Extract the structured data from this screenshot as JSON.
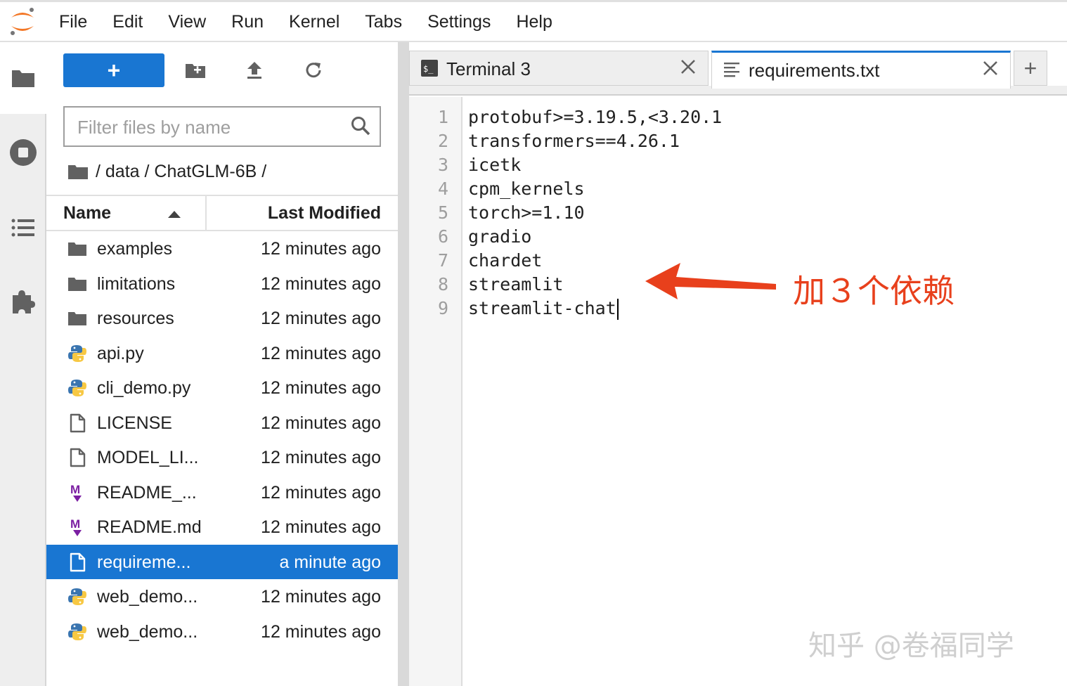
{
  "menu": [
    "File",
    "Edit",
    "View",
    "Run",
    "Kernel",
    "Tabs",
    "Settings",
    "Help"
  ],
  "activity_bar": [
    "folder-icon",
    "stop-circle-icon",
    "list-icon",
    "puzzle-icon"
  ],
  "file_browser": {
    "new_button_label": "+",
    "filter_placeholder": "Filter files by name",
    "breadcrumb": "/ data / ChatGLM-6B /",
    "columns": {
      "name": "Name",
      "modified": "Last Modified"
    },
    "files": [
      {
        "name": "examples",
        "modified": "12 minutes ago",
        "icon": "folder-icon"
      },
      {
        "name": "limitations",
        "modified": "12 minutes ago",
        "icon": "folder-icon"
      },
      {
        "name": "resources",
        "modified": "12 minutes ago",
        "icon": "folder-icon"
      },
      {
        "name": "api.py",
        "modified": "12 minutes ago",
        "icon": "python-icon"
      },
      {
        "name": "cli_demo.py",
        "modified": "12 minutes ago",
        "icon": "python-icon"
      },
      {
        "name": "LICENSE",
        "modified": "12 minutes ago",
        "icon": "file-icon"
      },
      {
        "name": "MODEL_LI...",
        "modified": "12 minutes ago",
        "icon": "file-icon"
      },
      {
        "name": "README_...",
        "modified": "12 minutes ago",
        "icon": "markdown-icon"
      },
      {
        "name": "README.md",
        "modified": "12 minutes ago",
        "icon": "markdown-icon"
      },
      {
        "name": "requireme...",
        "modified": "a minute ago",
        "icon": "file-icon",
        "selected": true
      },
      {
        "name": "web_demo...",
        "modified": "12 minutes ago",
        "icon": "python-icon"
      },
      {
        "name": "web_demo...",
        "modified": "12 minutes ago",
        "icon": "python-icon"
      }
    ]
  },
  "tabs": [
    {
      "label": "Terminal 3",
      "icon": "terminal-icon",
      "active": false
    },
    {
      "label": "requirements.txt",
      "icon": "text-file-icon",
      "active": true
    }
  ],
  "tab_add_label": "+",
  "editor": {
    "line_numbers": [
      "1",
      "2",
      "3",
      "4",
      "5",
      "6",
      "7",
      "8",
      "9"
    ],
    "lines": [
      "protobuf>=3.19.5,<3.20.1",
      "transformers==4.26.1",
      "icetk",
      "cpm_kernels",
      "torch>=1.10",
      "gradio",
      "chardet",
      "streamlit",
      "streamlit-chat"
    ]
  },
  "annotation": "加３个依赖",
  "watermark": "知乎 @卷福同学",
  "colors": {
    "accent": "#1976d2",
    "annotation": "#e8401c"
  }
}
